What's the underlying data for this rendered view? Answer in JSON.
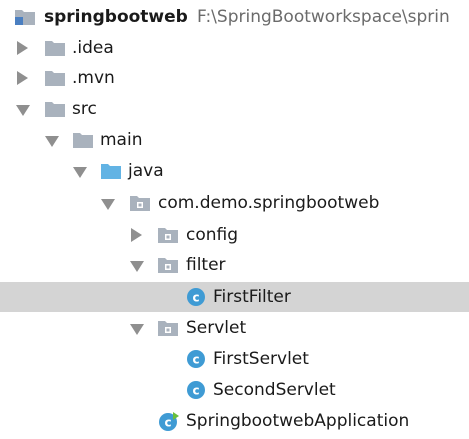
{
  "project_tree": {
    "root": {
      "name": "springbootweb",
      "path": "F:\\SpringBootworkspace\\sprin",
      "icon": "module-folder-icon"
    },
    "items": [
      {
        "label": ".idea",
        "icon": "folder-icon",
        "state": "collapsed"
      },
      {
        "label": ".mvn",
        "icon": "folder-icon",
        "state": "collapsed"
      },
      {
        "label": "src",
        "icon": "folder-icon",
        "state": "expanded"
      },
      {
        "label": "main",
        "icon": "folder-icon",
        "state": "expanded"
      },
      {
        "label": "java",
        "icon": "source-root-folder-icon",
        "state": "expanded"
      },
      {
        "label": "com.demo.springbootweb",
        "icon": "package-icon",
        "state": "expanded"
      },
      {
        "label": "config",
        "icon": "package-icon",
        "state": "collapsed"
      },
      {
        "label": "filter",
        "icon": "package-icon",
        "state": "expanded"
      },
      {
        "label": "FirstFilter",
        "icon": "java-class-icon",
        "state": "leaf",
        "selected": true
      },
      {
        "label": "Servlet",
        "icon": "package-icon",
        "state": "expanded"
      },
      {
        "label": "FirstServlet",
        "icon": "java-class-icon",
        "state": "leaf"
      },
      {
        "label": "SecondServlet",
        "icon": "java-class-icon",
        "state": "leaf"
      },
      {
        "label": "SpringbootwebApplication",
        "icon": "spring-boot-class-icon",
        "state": "leaf"
      }
    ]
  },
  "colors": {
    "folder": "#a9b2bd",
    "source_root_folder": "#62b3e4",
    "class_icon": "#3f9bd4",
    "selection": "#d4d4d4",
    "arrow": "#8f8f8f",
    "spring_badge": "#6abf3c"
  }
}
